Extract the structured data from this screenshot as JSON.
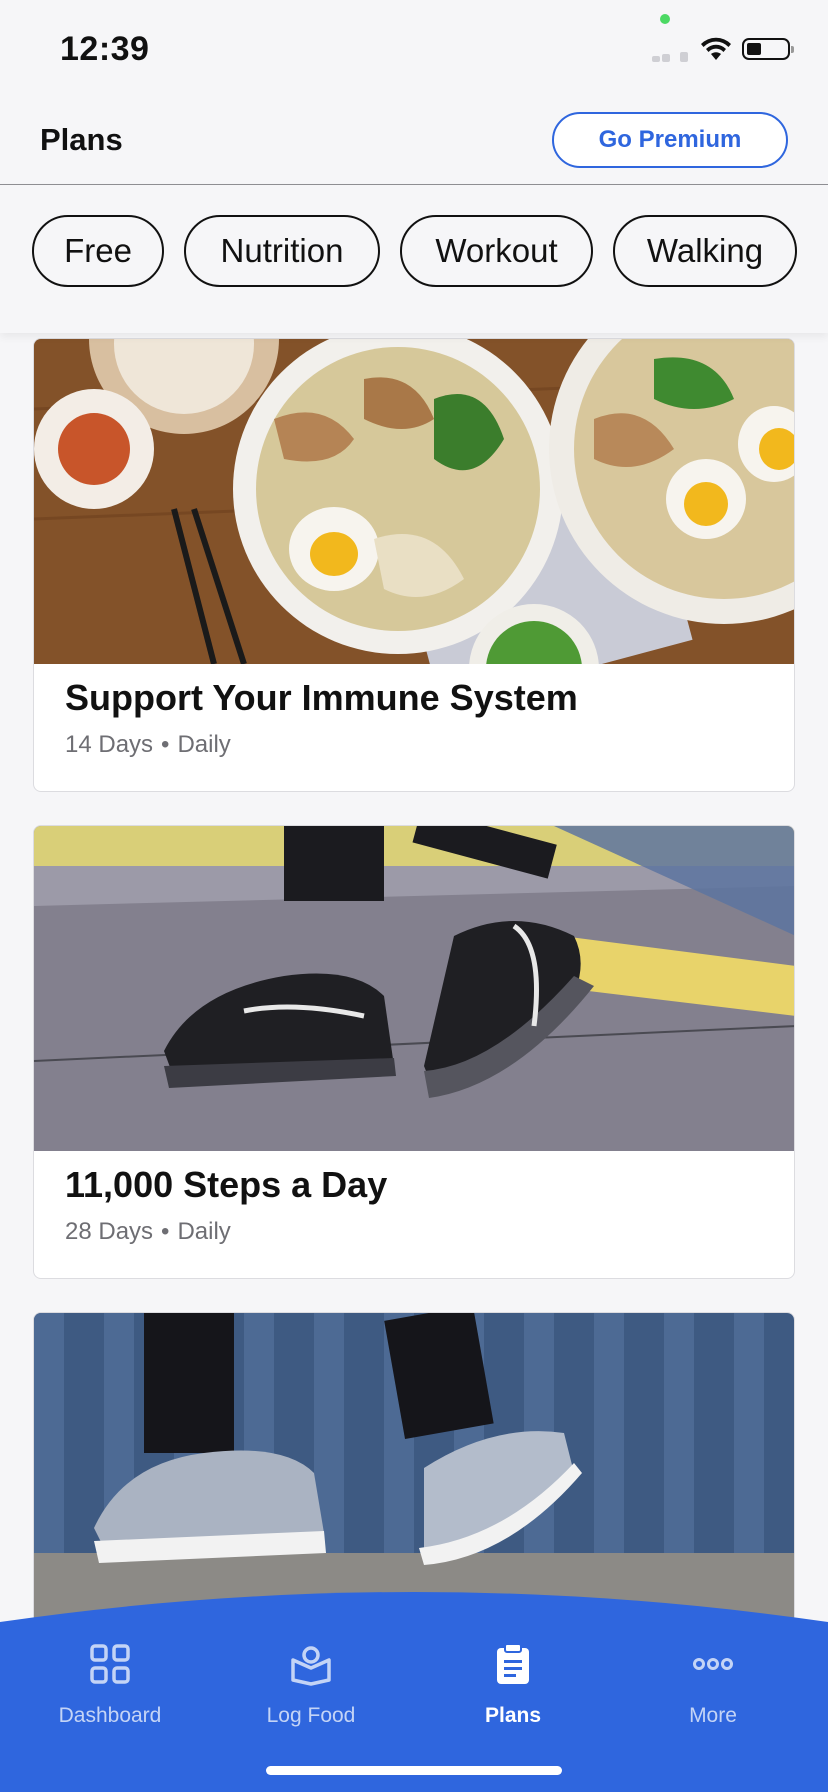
{
  "status_bar": {
    "time": "12:39"
  },
  "header": {
    "title": "Plans",
    "premium_label": "Go Premium"
  },
  "filters": [
    "Free",
    "Nutrition",
    "Workout",
    "Walking"
  ],
  "plans": [
    {
      "title": "Support Your Immune System",
      "duration": "14 Days",
      "frequency": "Daily",
      "image": "ramen-bowls-image"
    },
    {
      "title": "11,000 Steps a Day",
      "duration": "28 Days",
      "frequency": "Daily",
      "image": "black-sneakers-walking-image"
    },
    {
      "title": "",
      "duration": "",
      "frequency": "",
      "image": "gray-sneakers-walking-image"
    }
  ],
  "nav": {
    "items": [
      {
        "label": "Dashboard",
        "icon": "dashboard-icon"
      },
      {
        "label": "Log Food",
        "icon": "log-food-icon"
      },
      {
        "label": "Plans",
        "icon": "plans-icon",
        "active": true
      },
      {
        "label": "More",
        "icon": "more-icon"
      }
    ]
  },
  "colors": {
    "accent": "#2f66de",
    "nav_background": "#2f66de",
    "background": "#f6f6f8"
  }
}
